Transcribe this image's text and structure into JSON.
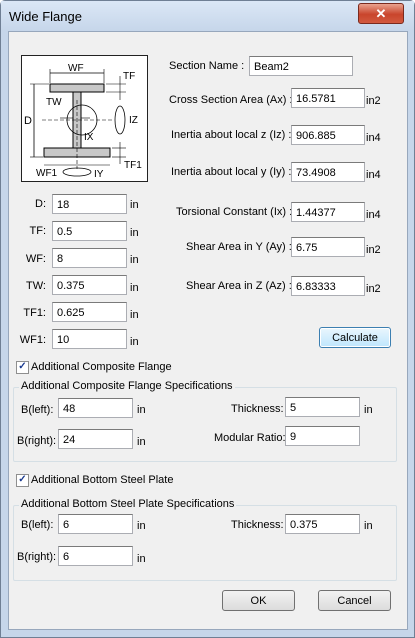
{
  "window": {
    "title": "Wide Flange",
    "close_glyph": "✕"
  },
  "diagram": {
    "labels": {
      "wf": "WF",
      "tf": "TF",
      "tw": "TW",
      "d": "D",
      "ix": "IX",
      "iz": "IZ",
      "wf1": "WF1",
      "tf1": "TF1",
      "iy": "IY"
    }
  },
  "section": {
    "name_label": "Section Name :",
    "name_value": "Beam2",
    "area_label": "Cross Section Area (Ax) :",
    "area_value": "16.5781",
    "area_unit": "in2",
    "iz_label": "Inertia about local z (Iz) :",
    "iz_value": "906.885",
    "iz_unit": "in4",
    "iy_label": "Inertia about local y (Iy) :",
    "iy_value": "73.4908",
    "iy_unit": "in4",
    "ix_label": "Torsional Constant (Ix) :",
    "ix_value": "1.44377",
    "ix_unit": "in4",
    "ay_label": "Shear Area in Y (Ay) :",
    "ay_value": "6.75",
    "ay_unit": "in2",
    "az_label": "Shear Area in Z (Az) :",
    "az_value": "6.83333",
    "az_unit": "in2"
  },
  "dims": [
    {
      "label": "D:",
      "value": "18",
      "unit": "in"
    },
    {
      "label": "TF:",
      "value": "0.5",
      "unit": "in"
    },
    {
      "label": "WF:",
      "value": "8",
      "unit": "in"
    },
    {
      "label": "TW:",
      "value": "0.375",
      "unit": "in"
    },
    {
      "label": "TF1:",
      "value": "0.625",
      "unit": "in"
    },
    {
      "label": "WF1:",
      "value": "10",
      "unit": "in"
    }
  ],
  "calculate_label": "Calculate",
  "composite": {
    "checkbox_label": "Additional Composite Flange",
    "checked": true,
    "check_glyph": "✓",
    "group_title": "Additional Composite Flange Specifications",
    "bleft_label": "B(left):",
    "bleft_value": "48",
    "bleft_unit": "in",
    "bright_label": "B(right):",
    "bright_value": "24",
    "bright_unit": "in",
    "thickness_label": "Thickness:",
    "thickness_value": "5",
    "thickness_unit": "in",
    "modular_label": "Modular Ratio:",
    "modular_value": "9"
  },
  "plate": {
    "checkbox_label": "Additional Bottom Steel Plate",
    "checked": true,
    "check_glyph": "✓",
    "group_title": "Additional Bottom Steel Plate Specifications",
    "bleft_label": "B(left):",
    "bleft_value": "6",
    "bleft_unit": "in",
    "bright_label": "B(right):",
    "bright_value": "6",
    "bright_unit": "in",
    "thickness_label": "Thickness:",
    "thickness_value": "0.375",
    "thickness_unit": "in"
  },
  "buttons": {
    "ok": "OK",
    "cancel": "Cancel"
  }
}
